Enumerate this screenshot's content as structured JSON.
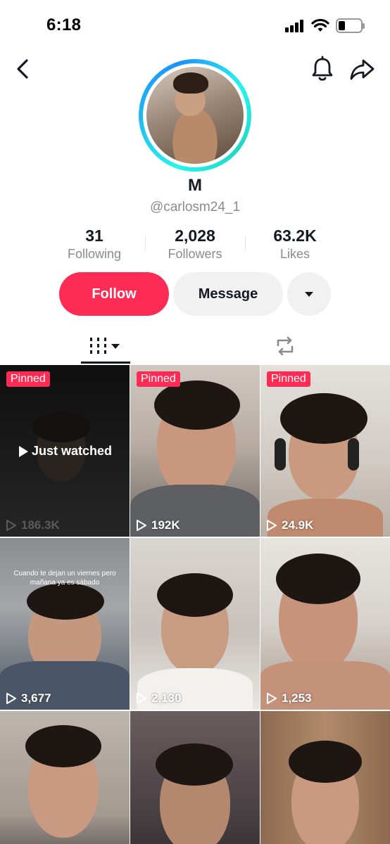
{
  "status_bar": {
    "time": "6:18"
  },
  "profile": {
    "display_name": "M",
    "username": "@carlosm24_1"
  },
  "stats": {
    "following": {
      "value": "31",
      "label": "Following"
    },
    "followers": {
      "value": "2,028",
      "label": "Followers"
    },
    "likes": {
      "value": "63.2K",
      "label": "Likes"
    }
  },
  "actions": {
    "follow_label": "Follow",
    "message_label": "Message"
  },
  "colors": {
    "accent": "#fe2c55",
    "ring": "#25f4ee",
    "secondary_button": "#f1f1f2"
  },
  "tabs": [
    {
      "icon": "grid-list-icon",
      "selected": true
    },
    {
      "icon": "repost-icon",
      "selected": false
    }
  ],
  "videos": [
    {
      "pinned": "Pinned",
      "views": "186.3K",
      "overlay": "Just watched"
    },
    {
      "pinned": "Pinned",
      "views": "192K"
    },
    {
      "pinned": "Pinned",
      "views": "24.9K"
    },
    {
      "views": "3,677",
      "caption": "Cuando te dejan un viernes pero mañana ya es sábado"
    },
    {
      "views": "2,130"
    },
    {
      "views": "1,253"
    },
    {
      "views": ""
    },
    {
      "views": ""
    },
    {
      "views": ""
    }
  ]
}
